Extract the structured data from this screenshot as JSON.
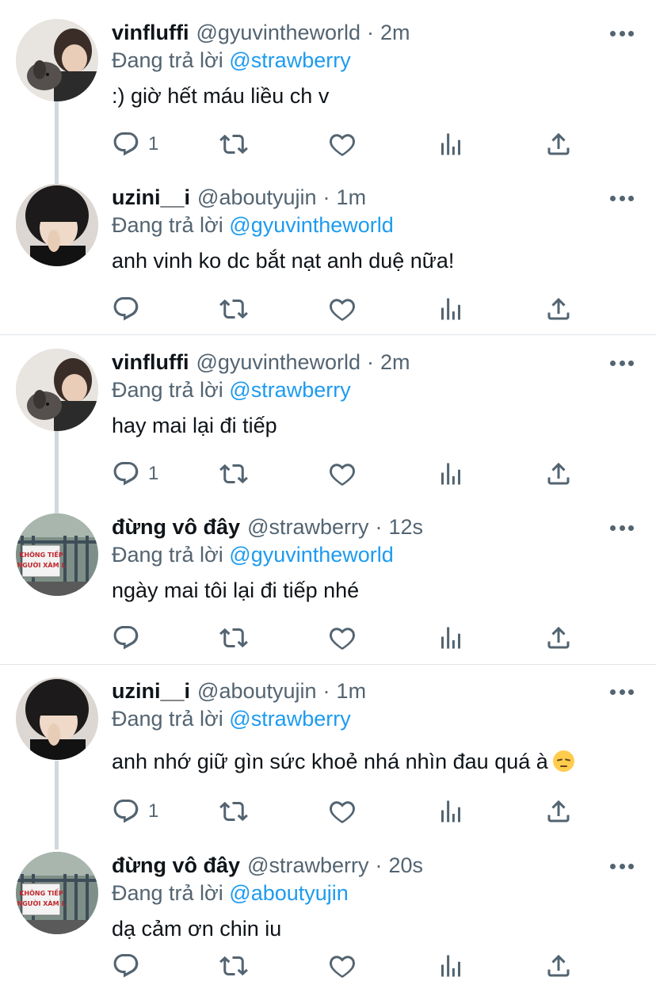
{
  "tweets": [
    {
      "name": "vinfluffi",
      "handle": "@gyuvintheworld",
      "separator": "·",
      "time": "2m",
      "replying_prefix": "Đang trả lời",
      "replying_to": "@strawberry",
      "text": ":) giờ hết máu liều ch v",
      "reply_count": "1",
      "avatar": "boy-with-dog-avatar"
    },
    {
      "name": "uzini__i",
      "handle": "@aboutyujin",
      "separator": "·",
      "time": "1m",
      "replying_prefix": "Đang trả lời",
      "replying_to": "@gyuvintheworld",
      "text": "anh vinh ko dc bắt nạt anh duệ nữa!",
      "reply_count": "",
      "avatar": "girl-hand-face-avatar"
    },
    {
      "name": "vinfluffi",
      "handle": "@gyuvintheworld",
      "separator": "·",
      "time": "2m",
      "replying_prefix": "Đang trả lời",
      "replying_to": "@strawberry",
      "text": "hay mai lại đi tiếp",
      "reply_count": "1",
      "avatar": "boy-with-dog-avatar"
    },
    {
      "name": "đừng vô đây",
      "handle": "@strawberry",
      "separator": "·",
      "time": "12s",
      "replying_prefix": "Đang trả lời",
      "replying_to": "@gyuvintheworld",
      "text": "ngày mai tôi lại đi tiếp nhé",
      "reply_count": "",
      "avatar": "gate-sign-avatar",
      "sign_line1": "KHÔNG TIẾP",
      "sign_line2": "NGƯỜI XÀM L"
    },
    {
      "name": "uzini__i",
      "handle": "@aboutyujin",
      "separator": "·",
      "time": "1m",
      "replying_prefix": "Đang trả lời",
      "replying_to": "@strawberry",
      "text": "anh nhớ giữ gìn sức khoẻ nhá nhìn đau quá à",
      "emoji": "pensive-face-emoji",
      "reply_count": "1",
      "avatar": "girl-hand-face-avatar"
    },
    {
      "name": "đừng vô đây",
      "handle": "@strawberry",
      "separator": "·",
      "time": "20s",
      "replying_prefix": "Đang trả lời",
      "replying_to": "@aboutyujin",
      "text": "dạ cảm ơn chin iu",
      "reply_count": "",
      "avatar": "gate-sign-avatar",
      "sign_line1": "KHÔNG TIẾP",
      "sign_line2": "NGƯỜI XÀM L"
    }
  ],
  "icons": {
    "reply": "reply-icon",
    "retweet": "retweet-icon",
    "like": "like-icon",
    "views": "views-icon",
    "share": "share-icon",
    "more": "more-icon"
  },
  "colors": {
    "mention": "#1d9bf0",
    "secondary_text": "#536471",
    "divider": "#e1e5e8",
    "thread_line": "#cfd9de"
  }
}
